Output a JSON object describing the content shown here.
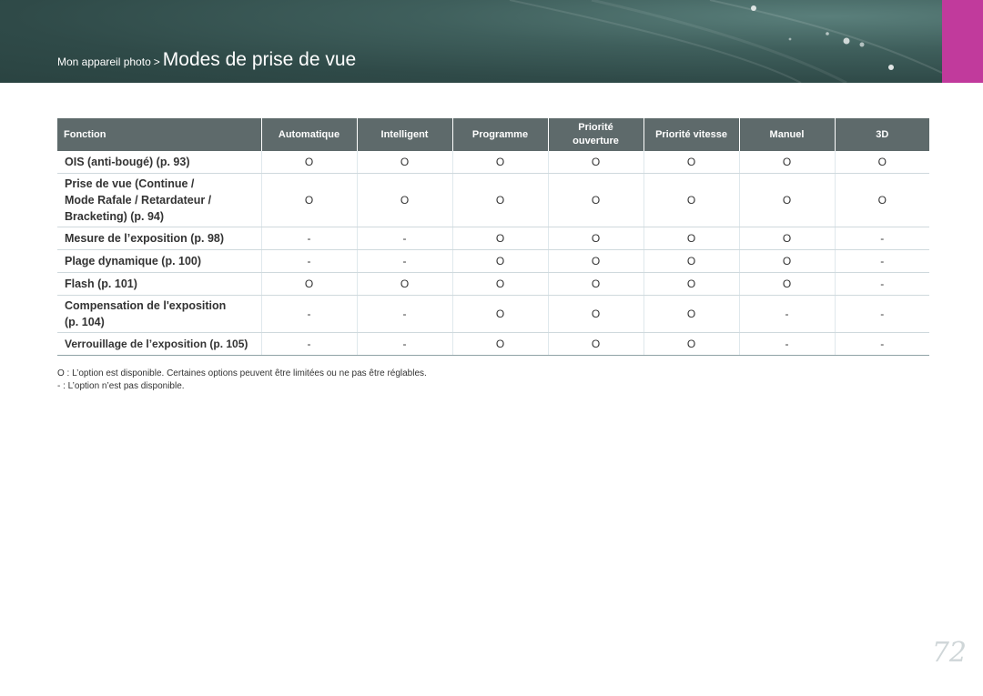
{
  "header": {
    "breadcrumb_parent": "Mon appareil photo",
    "separator": ">",
    "title": "Modes de prise de vue",
    "banner_color": "#3f5f5c",
    "accent_color": "#c13a9c"
  },
  "table": {
    "columns": [
      "Fonction",
      "Automatique",
      "Intelligent",
      "Programme",
      "Priorité ouverture",
      "Priorité vitesse",
      "Manuel",
      "3D"
    ],
    "rows": [
      {
        "function": "OIS (anti-bougé) (p. 93)",
        "values": [
          "O",
          "O",
          "O",
          "O",
          "O",
          "O",
          "O"
        ]
      },
      {
        "function": "Prise de vue (Continue / Mode Rafale / Retardateur / Bracketing) (p. 94)",
        "values": [
          "O",
          "O",
          "O",
          "O",
          "O",
          "O",
          "O"
        ]
      },
      {
        "function": "Mesure de l’exposition (p. 98)",
        "values": [
          "-",
          "-",
          "O",
          "O",
          "O",
          "O",
          "-"
        ]
      },
      {
        "function": "Plage dynamique (p. 100)",
        "values": [
          "-",
          "-",
          "O",
          "O",
          "O",
          "O",
          "-"
        ]
      },
      {
        "function": "Flash (p. 101)",
        "values": [
          "O",
          "O",
          "O",
          "O",
          "O",
          "O",
          "-"
        ]
      },
      {
        "function": "Compensation de l'exposition (p. 104)",
        "values": [
          "-",
          "-",
          "O",
          "O",
          "O",
          "-",
          "-"
        ]
      },
      {
        "function": "Verrouillage de l’exposition (p. 105)",
        "values": [
          "-",
          "-",
          "O",
          "O",
          "O",
          "-",
          "-"
        ]
      }
    ]
  },
  "notes": [
    "O : L’option est disponible. Certaines options peuvent être limitées ou ne pas être réglables.",
    "- : L’option n’est pas disponible."
  ],
  "page_number": "72"
}
